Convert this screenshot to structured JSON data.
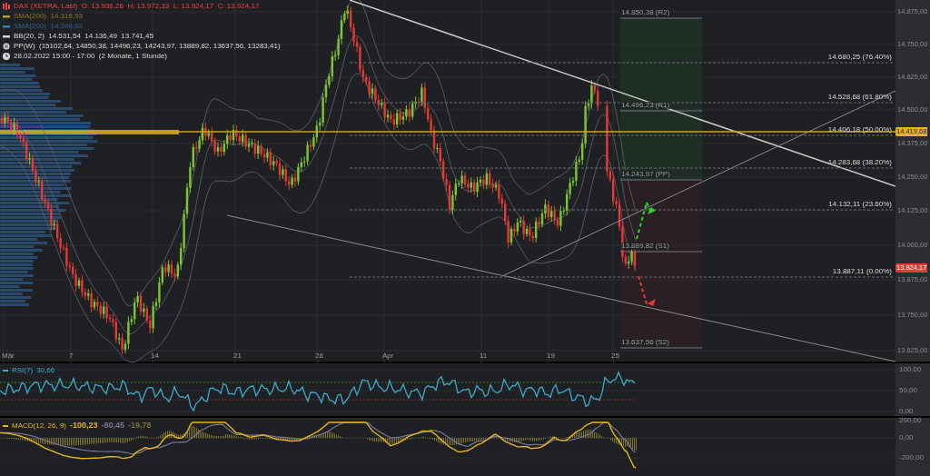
{
  "legend": [
    {
      "kind": "candles",
      "text": "DAX (XETRA, Last)  O: 13.936,26  H: 13.972,33  L: 13.924,17  C: 13.924,17",
      "color": "#e84545",
      "visible": true
    },
    {
      "kind": "line",
      "text": "SMA(200)  14.316,93",
      "color": "#b59a2a",
      "visible": false
    },
    {
      "kind": "line",
      "text": "SMA(200)  14.246,03",
      "color": "#3d7ab8",
      "visible": false
    },
    {
      "kind": "line",
      "text": "BB(20, 2)  14.531,54  14.136,49  13.741,45",
      "color": "#d8d8d8",
      "visible": true
    },
    {
      "kind": "pivots",
      "text": "PP(W)  (15102,64, 14850,38, 14496,23, 14243,97, 13889,82, 13637,56, 13283,41)",
      "color": "#d8d8d8",
      "visible": true
    },
    {
      "kind": "clock",
      "text": "28.02.2022 15:00 - 17:00  (2 Monate, 1 Stunde)",
      "color": "#d8d8d8",
      "visible": true
    }
  ],
  "fib_levels": [
    "14.680,25 (76.40%)",
    "14.528,68 (61.80%)",
    "14.406,18 (50.00%)",
    "14.283,68 (38.20%)",
    "14.132,11 (23.60%)",
    "13.887,11 (0.00%)"
  ],
  "pivot_labels": [
    "14.850,38 (R2)",
    "14.496,23 (R1)",
    "14.243,97 (PP)",
    "13.889,82 (S1)",
    "13.637,56 (S2)"
  ],
  "price_axis": [
    "14.875,00",
    "14.750,00",
    "14.625,00",
    "14.500,00",
    "14.375,00",
    "14.250,00",
    "14.125,00",
    "14.000,00",
    "13.875,00",
    "13.750,00",
    "13.625,00"
  ],
  "price_tags": [
    {
      "text": "14.419,68",
      "color": "#e6b422"
    },
    {
      "text": "13.924,17",
      "color": "#e53935"
    }
  ],
  "date_axis": [
    "Mär",
    "7",
    "14",
    "21",
    "28",
    "Apr",
    "11",
    "19",
    "25"
  ],
  "rsi": {
    "label": "RSI(7)",
    "value": "30,66",
    "color": "#3fa9c9",
    "axis": [
      "100,00",
      "50,00",
      "0,00"
    ]
  },
  "macd": {
    "label": "MACD(12, 26, 9)",
    "values": [
      {
        "text": "-100,23",
        "color": "#e6b422"
      },
      {
        "text": "-80,45",
        "color": "#7a7696"
      },
      {
        "text": "-19,78",
        "color": "#7d7432"
      }
    ],
    "color": "#e6b422",
    "axis": [
      "200,00",
      "0,00",
      "-200,00"
    ]
  }
}
